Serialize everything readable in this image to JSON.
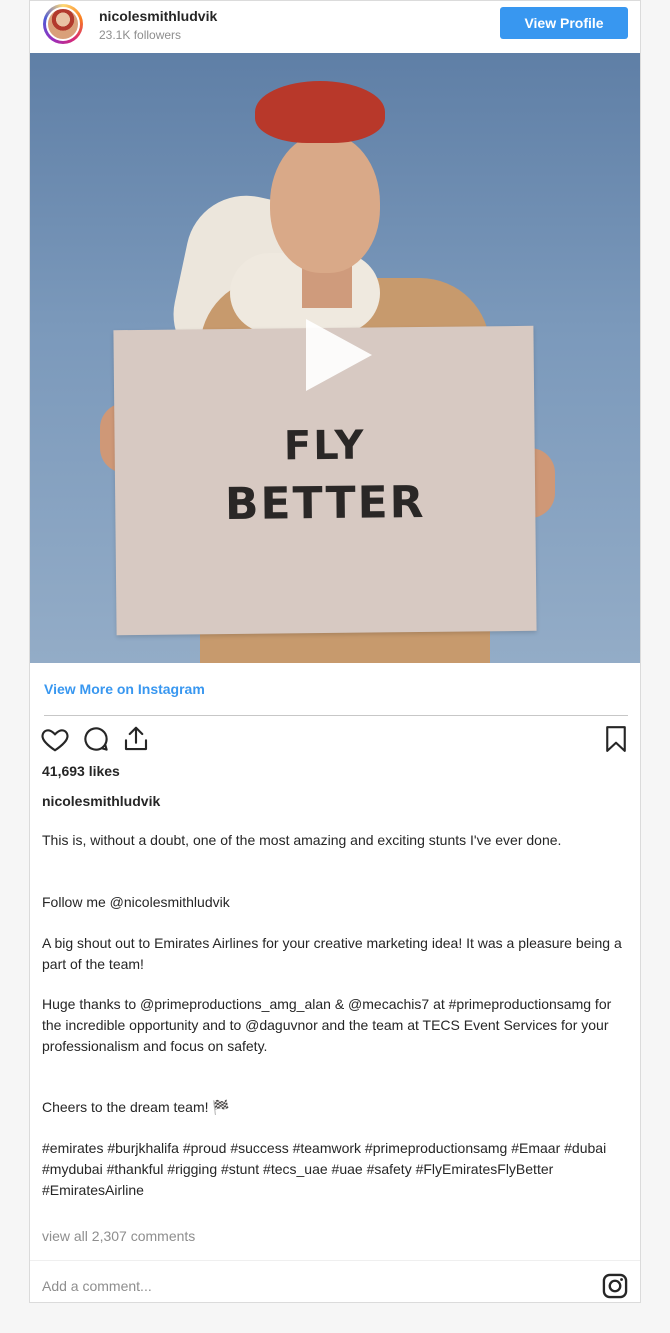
{
  "header": {
    "username": "nicolesmithludvik",
    "followers": "23.1K followers",
    "view_profile_label": "View Profile"
  },
  "media": {
    "sign_line1": "FLY",
    "sign_line2": "BETTER"
  },
  "view_more_label": "View More on Instagram",
  "actions": {
    "like_icon": "heart-icon",
    "comment_icon": "comment-icon",
    "share_icon": "share-icon",
    "save_icon": "bookmark-icon"
  },
  "likes": "41,693 likes",
  "author": "nicolesmithludvik",
  "caption": {
    "p1": "This is, without a doubt, one of the most amazing and exciting stunts I've ever done.",
    "p2": "Follow me @nicolesmithludvik",
    "p3": "A big shout out to Emirates Airlines for your creative marketing idea! It was a pleasure being a part of the team!",
    "p4": "Huge thanks to @primeproductions_amg_alan & @mecachis7 at #primeproductionsamg for the incredible opportunity and to @daguvnor and the team at TECS Event Services for your professionalism and focus on safety.",
    "p5": "Cheers to the dream team! 🏁",
    "p6": "#emirates #burjkhalifa #proud #success #teamwork #primeproductionsamg #Emaar #dubai #mydubai #thankful #rigging #stunt #tecs_uae #uae #safety #FlyEmiratesFlyBetter #EmiratesAirline"
  },
  "view_all_comments": "view all 2,307 comments",
  "comment": {
    "placeholder": "Add a comment...",
    "icon": "instagram-icon"
  },
  "colors": {
    "accent": "#3897f0",
    "text": "#262626",
    "muted": "#8e8e8e"
  }
}
